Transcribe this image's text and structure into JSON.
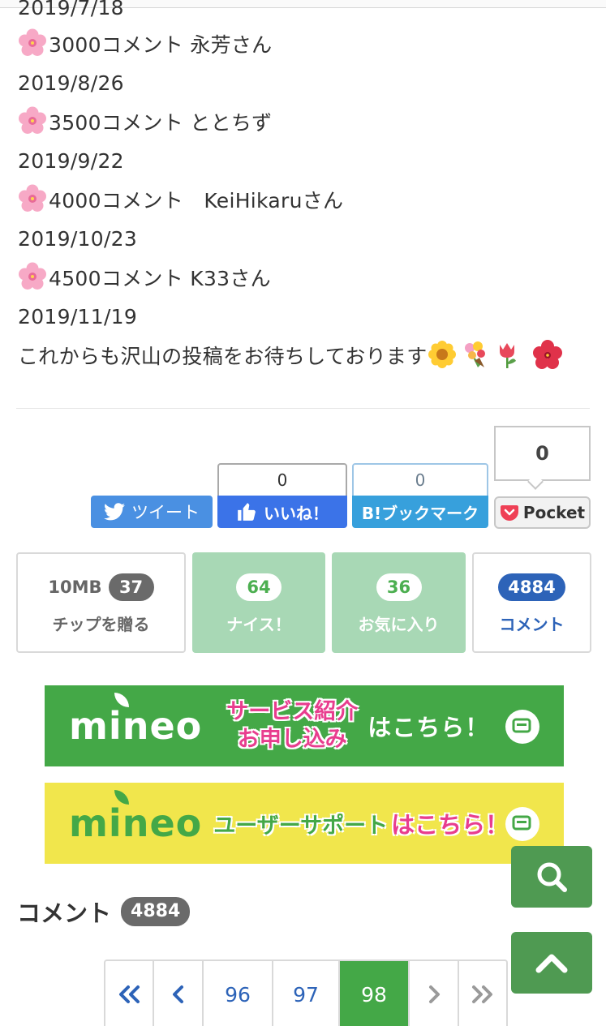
{
  "post": {
    "partial_top": "2019/7/18",
    "lines": [
      {
        "text": "3000コメント 永芳さん",
        "flower": true
      },
      {
        "text": "2019/8/26",
        "flower": false
      },
      {
        "text": "3500コメント ととちず",
        "flower": true
      },
      {
        "text": "2019/9/22",
        "flower": false
      },
      {
        "text": "4000コメント　KeiHikaruさん",
        "flower": true
      },
      {
        "text": "2019/10/23",
        "flower": false
      },
      {
        "text": "4500コメント K33さん",
        "flower": true
      },
      {
        "text": "2019/11/19",
        "flower": false
      }
    ],
    "closing": "これからも沢山の投稿をお待ちしております",
    "closing_emojis": [
      "sunflower-emoji",
      "bouquet-emoji",
      "tulip-emoji",
      "hibiscus-emoji"
    ]
  },
  "share": {
    "tweet_label": "ツイート",
    "facebook_count": "0",
    "facebook_label": "いいね！",
    "hatena_count": "0",
    "hatena_label": "B!ブックマーク",
    "pocket_count": "0",
    "pocket_label": "Pocket"
  },
  "reactions": {
    "tip_amount": "10MB",
    "tip_count": "37",
    "tip_label": "チップを贈る",
    "nice_count": "64",
    "nice_label": "ナイス！",
    "fav_count": "36",
    "fav_label": "お気に入り",
    "comment_count": "4884",
    "comment_label": "コメント"
  },
  "banners": {
    "service_logo": "mineo",
    "service_line1": "サービス紹介",
    "service_line2": "お申し込み",
    "service_right": "はこちら！",
    "support_logo": "mineo",
    "support_mid": "ユーザーサポート",
    "support_right": "はこちら！"
  },
  "comments": {
    "title": "コメント",
    "count": "4884"
  },
  "pagination": {
    "pages": [
      "96",
      "97",
      "98"
    ],
    "current": "98"
  },
  "colors": {
    "accent_green": "#44a847",
    "link_blue": "#2d63b8",
    "twitter": "#4a90e2",
    "facebook": "#3b73e8",
    "hatena": "#37a0dc",
    "mineo_pink": "#e83d8e",
    "banner_yellow": "#f1e64c"
  }
}
